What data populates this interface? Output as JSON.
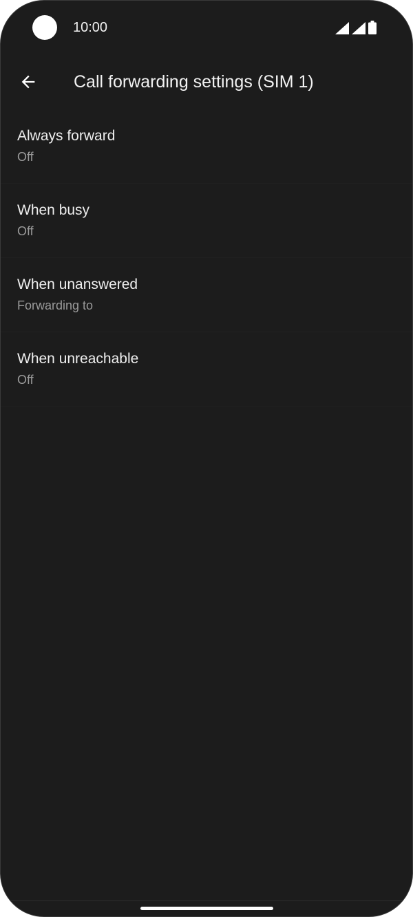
{
  "status_bar": {
    "time": "10:00",
    "icons": [
      "signal-sim1-icon",
      "signal-sim2-icon",
      "battery-icon"
    ]
  },
  "app_bar": {
    "back_icon": "arrow-back-icon",
    "title": "Call forwarding settings (SIM 1)"
  },
  "settings": {
    "items": [
      {
        "title": "Always forward",
        "summary": "Off"
      },
      {
        "title": "When busy",
        "summary": "Off"
      },
      {
        "title": "When unanswered",
        "summary": "Forwarding to"
      },
      {
        "title": "When unreachable",
        "summary": "Off"
      }
    ]
  },
  "colors": {
    "background": "#1c1c1c",
    "primary_text": "#eeeeee",
    "secondary_text": "#9a9a9a",
    "icon": "#ffffff"
  }
}
